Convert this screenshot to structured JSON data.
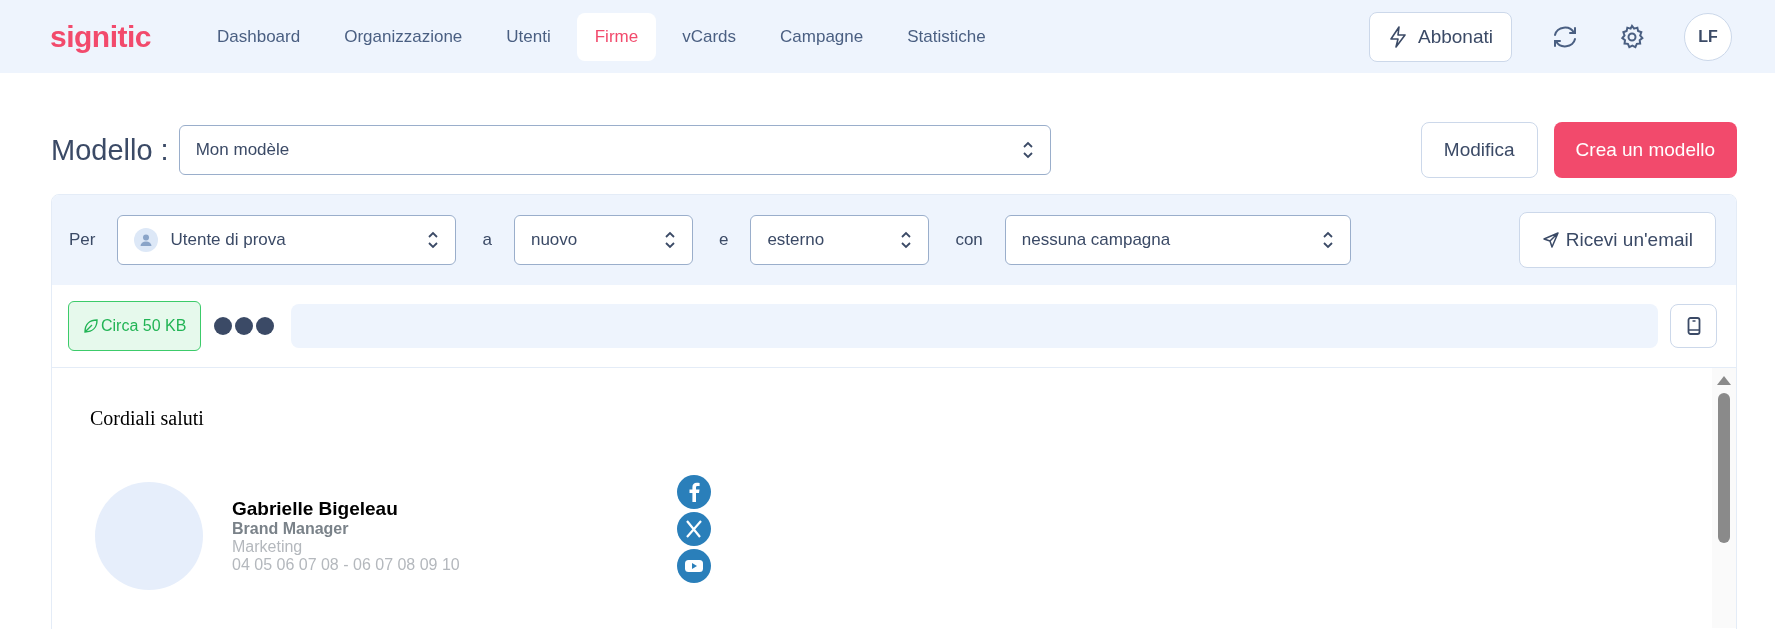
{
  "logo": "signitic",
  "nav": [
    {
      "label": "Dashboard",
      "selected": false
    },
    {
      "label": "Organizzazione",
      "selected": false
    },
    {
      "label": "Utenti",
      "selected": false
    },
    {
      "label": "Firme",
      "selected": true
    },
    {
      "label": "vCards",
      "selected": false
    },
    {
      "label": "Campagne",
      "selected": false
    },
    {
      "label": "Statistiche",
      "selected": false
    }
  ],
  "subscribe": "Abbonati",
  "avatar": "LF",
  "model": {
    "label": "Modello :",
    "value": "Mon modèle"
  },
  "edit_button": "Modifica",
  "create_button": "Crea un modello",
  "filters": [
    {
      "label": "Per",
      "value": "Utente di prova",
      "kind": "user"
    },
    {
      "label": "a",
      "value": "nuovo",
      "kind": "plain"
    },
    {
      "label": "e",
      "value": "esterno",
      "kind": "plain"
    },
    {
      "label": "con",
      "value": "nessuna campagna",
      "kind": "plain"
    }
  ],
  "send_button": "Ricevi un'email",
  "size_badge": "Circa 50 KB",
  "signature": {
    "greeting": "Cordiali saluti",
    "name": "Gabrielle Bigeleau",
    "title": "Brand Manager",
    "department": "Marketing",
    "phone": "04 05 06 07 08 - 06 07 08 09 10"
  }
}
